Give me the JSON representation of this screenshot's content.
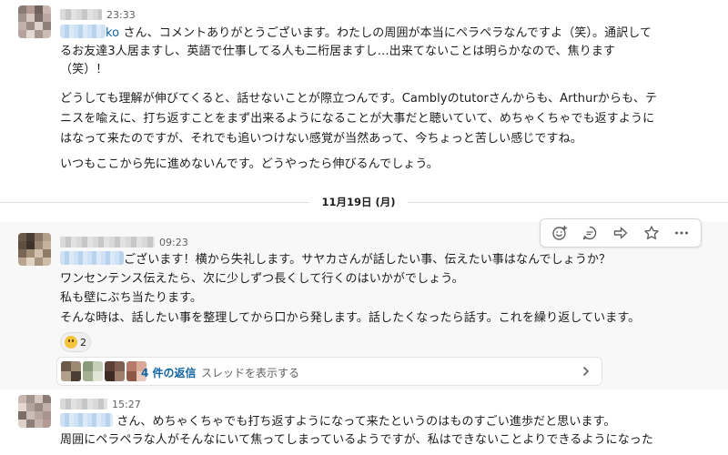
{
  "colors": {
    "link": "#1264a3",
    "muted": "#616061",
    "text": "#1d1c1d",
    "reaction_emoji": "#f5c33b"
  },
  "messages": [
    {
      "time": "23:33",
      "mention_suffix": "ko",
      "lines": [
        "さん、コメントありがとうございます。わたしの周囲が本当にペラペラなんですよ（笑）。通訳して",
        "るお友達3人居ますし、英語で仕事してる人も二桁居ますし…出来てないことは明らかなので、焦ります",
        "（笑）！",
        "どうしても理解が伸びてくると、話せないことが際立つんです。Camblyのtutorさんからも、Arthurからも、テ",
        "ニスを喩えに、打ち返すことをまず出来るようになることが大事だと聴いていて、めちゃくちゃでも返すように",
        "はなって来たのですが、それでも追いつけない感覚が当然あって、今ちょっと苦しい感じですね。",
        "いつもここから先に進めないんです。どうやったら伸びるんでしょう。"
      ]
    },
    {
      "time": "09:23",
      "lines": [
        "ございます！横から失礼します。サヤカさんが話したい事、伝えたい事はなんでしょうか？",
        "ワンセンテンス伝えたら、次に少しずつ長くして行くのはいかがでしょう。",
        "私も壁にぶち当たります。",
        "そんな時は、話したい事を整理してから口から発します。話したくなったら話す。これを繰り返しています。"
      ],
      "reaction": {
        "emoji_icon": "smile-emoji-icon",
        "count": "2"
      },
      "thread": {
        "reply_count": "4 件の返信",
        "view_label": "スレッドを表示する"
      }
    },
    {
      "time": "15:27",
      "lines": [
        "さん、めちゃくちゃでも打ち返すようになって来たというのはものすごい進歩だと思います。",
        "周囲にペラペラな人がそんなにいて焦ってしまっているようですが、私はできないことよりできるようになった"
      ]
    }
  ],
  "date_divider": {
    "label": "11月19日 (月)"
  },
  "toolbar": {
    "buttons": [
      {
        "icon": "add-reaction-icon"
      },
      {
        "icon": "reply-in-thread-icon"
      },
      {
        "icon": "share-message-icon"
      },
      {
        "icon": "save-star-icon"
      },
      {
        "icon": "more-actions-icon"
      }
    ]
  }
}
